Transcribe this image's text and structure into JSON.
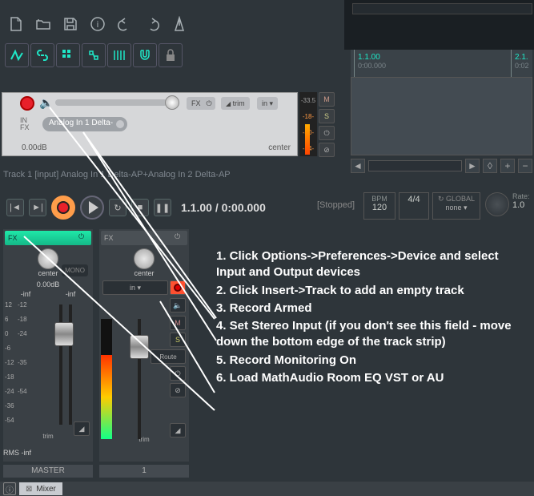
{
  "ruler": {
    "m1": "1.1.00",
    "m1s": "0:00.000",
    "m2": "2.1.",
    "m2s": "0:02"
  },
  "track": {
    "num": "1",
    "in_lbl": "IN\nFX",
    "input_name": "Analog In 1 Delta-",
    "db": "0.00dB",
    "pan": "center",
    "fx": "FX",
    "pwr": "⏻",
    "trim": "trim",
    "in": "in",
    "meter": [
      "-33.5",
      "-18-",
      "-30-",
      "-54-"
    ],
    "btns": [
      "M",
      "S",
      "⏻",
      "⊘"
    ]
  },
  "track_label": "Track 1 [input] Analog In 1 Delta-AP+Analog In 2 Delta-AP",
  "transport": {
    "time": "1.1.00 / 0:00.000",
    "status": "[Stopped]"
  },
  "bpm": {
    "lbl": "BPM",
    "val": "120"
  },
  "ts": {
    "lbl": "4/4",
    "val": ""
  },
  "global": {
    "lbl": "↻ GLOBAL",
    "val": "none ▾"
  },
  "rate": {
    "lbl": "Rate:",
    "val": "1.0"
  },
  "mixer": {
    "master": {
      "fx": "FX",
      "pan": "center",
      "mono": "MONO",
      "db": "0.00dB",
      "inf": "-inf",
      "route": "trim",
      "name": "MASTER"
    },
    "ch1": {
      "fx": "FX",
      "pan": "center",
      "in": "in ▾",
      "route": "Route",
      "name": "1",
      "trim": "trim"
    },
    "scale": [
      "12",
      "6",
      "0",
      "-6",
      "-12",
      "-18",
      "-24",
      "-36",
      "-54"
    ],
    "scale2": [
      "-12",
      "-18",
      "-24",
      "-35",
      "-54"
    ],
    "meter_nums": [
      "-33.",
      "-18-",
      "-30-",
      "-54-"
    ],
    "side": [
      "M",
      "S",
      "Route"
    ],
    "rms": "RMS   -inf"
  },
  "instructions": [
    "1. Click Options->Preferences->Device and select Input and Output devices",
    "2. Click Insert->Track to add an empty track",
    "3. Record Armed",
    "4. Set Stereo Input (if you don't see this field - move down the bottom edge of the track strip)",
    "5. Record Monitoring On",
    "6. Load MathAudio Room EQ VST or AU"
  ],
  "bottom": {
    "tab": "Mixer"
  }
}
